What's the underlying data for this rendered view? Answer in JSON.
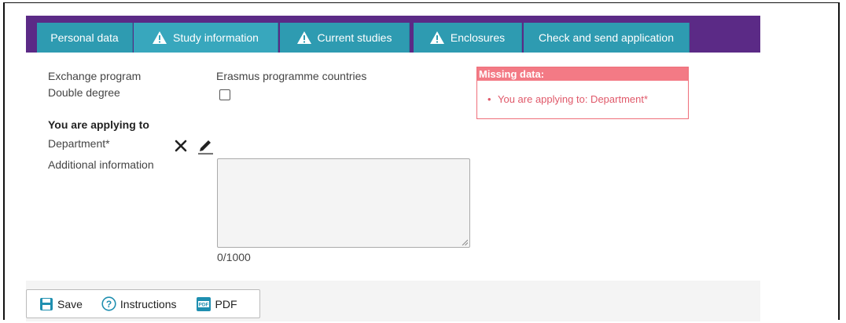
{
  "tabs": [
    {
      "label": "Personal data",
      "warning": false,
      "active": false
    },
    {
      "label": "Study information",
      "warning": true,
      "active": true
    },
    {
      "label": "Current studies",
      "warning": true,
      "active": false
    },
    {
      "label": "Enclosures",
      "warning": true,
      "active": false
    },
    {
      "label": "Check and send application",
      "warning": false,
      "active": false
    }
  ],
  "form": {
    "exchange_program_label": "Exchange program",
    "exchange_program_value": "Erasmus programme countries",
    "double_degree_label": "Double degree",
    "double_degree_checked": false,
    "applying_heading": "You are applying to",
    "department_label": "Department*",
    "additional_info_label": "Additional information",
    "additional_info_value": "",
    "char_counter": "0/1000"
  },
  "missing_data": {
    "title": "Missing data:",
    "items": [
      "You are applying to: Department*"
    ]
  },
  "toolbar": {
    "save_label": "Save",
    "instructions_label": "Instructions",
    "pdf_label": "PDF"
  },
  "colors": {
    "tabbar": "#5b2a86",
    "tab": "#2e9bb1",
    "missing_header": "#f37a85",
    "missing_text": "#e0596a",
    "save_icon": "#1f8fb0"
  }
}
